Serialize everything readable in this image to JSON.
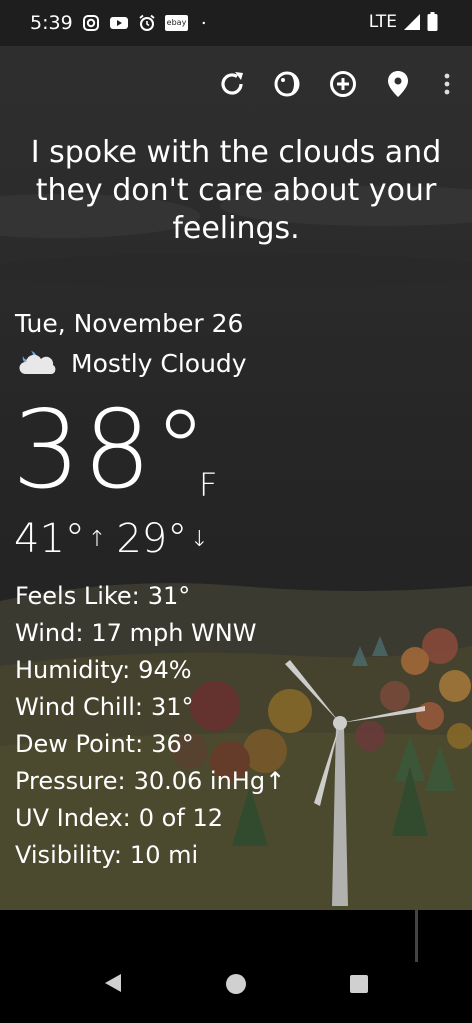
{
  "status": {
    "time": "5:39",
    "network": "LTE",
    "left_icons": [
      "instagram-icon",
      "youtube-icon",
      "alarm-icon",
      "ebay-icon",
      "dot-icon"
    ],
    "ebay_text": "ebay"
  },
  "toolbar": {
    "icons": [
      "refresh-icon",
      "theme-icon",
      "add-location-icon",
      "location-pin-icon",
      "more-vert-icon"
    ]
  },
  "quote": "I spoke with the clouds and they don't care about your feelings.",
  "weather": {
    "date": "Tue, November 26",
    "condition": "Mostly Cloudy",
    "temp": "38°",
    "unit": "F",
    "high": "41°",
    "low": "29°",
    "high_arrow": "↑",
    "low_arrow": "↓"
  },
  "details": [
    {
      "label": "Feels Like:",
      "value": "31°"
    },
    {
      "label": "Wind:",
      "value": "17 mph WNW"
    },
    {
      "label": "Humidity:",
      "value": "94%"
    },
    {
      "label": "Wind Chill:",
      "value": "31°"
    },
    {
      "label": "Dew Point:",
      "value": "36°"
    },
    {
      "label": "Pressure:",
      "value": "30.06 inHg↑"
    },
    {
      "label": "UV Index:",
      "value": "0 of 12"
    },
    {
      "label": "Visibility:",
      "value": "10 mi"
    }
  ],
  "nav": [
    "back-icon",
    "home-icon",
    "recents-icon"
  ]
}
